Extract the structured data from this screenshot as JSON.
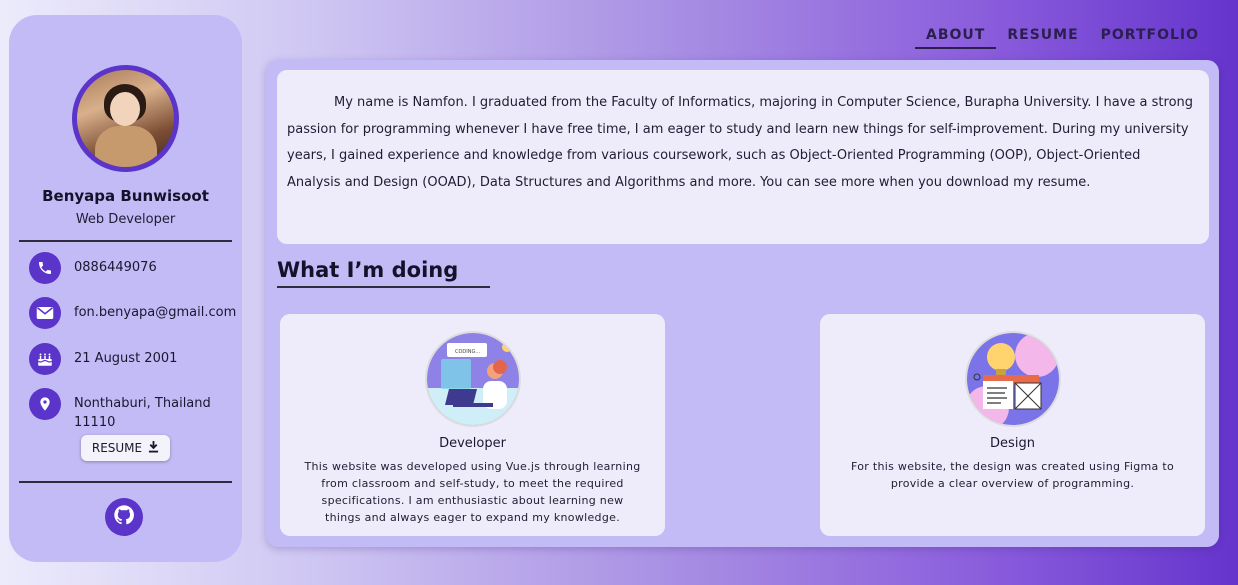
{
  "profile": {
    "name": "Benyapa Bunwisoot",
    "role": "Web Developer"
  },
  "contacts": [
    {
      "icon": "phone-icon",
      "text": "0886449076"
    },
    {
      "icon": "email-icon",
      "text": "fon.benyapa@gmail.com"
    },
    {
      "icon": "birthday-cake-icon",
      "text": "21 August 2001"
    },
    {
      "icon": "location-pin-icon",
      "text": "Nonthaburi, Thailand 11110"
    }
  ],
  "sidebar": {
    "resume_label": "RESUME",
    "github_icon": "github-icon"
  },
  "nav": {
    "about": "ABOUT",
    "resume": "RESUME",
    "portfolio": "PORTFOLIO"
  },
  "about": {
    "text": "My name is Namfon. I graduated from the Faculty of Informatics, majoring in Computer Science, Burapha University. I have a strong passion for programming whenever I have free time, I am eager to study and learn new things for self-improvement. During my university years, I gained experience and knowledge from various coursework, such as Object-Oriented Programming (OOP), Object-Oriented Analysis and Design (OOAD), Data Structures and Algorithms and more. You can see more when you download my resume."
  },
  "doing": {
    "title": "What I’m doing",
    "cards": [
      {
        "title": "Developer",
        "desc": "This website was developed using Vue.js through learning from classroom and self-study, to meet the required specifications. I am enthusiastic about learning new things and always eager to expand my knowledge.",
        "illustration_text": "CODING..."
      },
      {
        "title": "Design",
        "desc": "For this website, the design was created using Figma to provide a clear overview of programming."
      }
    ]
  },
  "colors": {
    "accent": "#5b34c9",
    "panel": "#c2bbf6",
    "card": "#eeecfa"
  }
}
